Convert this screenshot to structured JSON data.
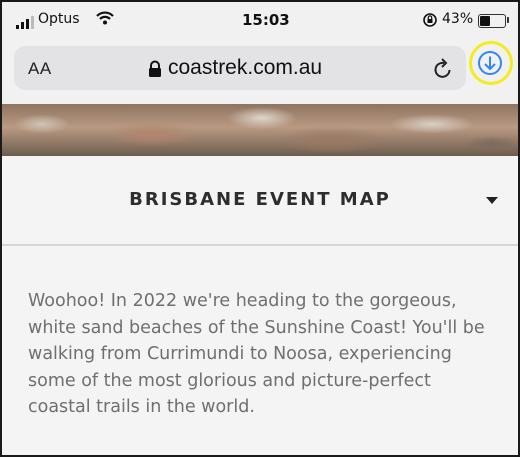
{
  "status_bar": {
    "carrier": "Optus",
    "time": "15:03",
    "battery_percent": "43%",
    "battery_level": 0.43,
    "icons": [
      "signal-bars-icon",
      "wifi-icon",
      "rotation-lock-icon",
      "battery-icon"
    ]
  },
  "address_bar": {
    "text_size_label": "AA",
    "url": "coastrek.com.au",
    "icons": [
      "padlock-icon",
      "reload-icon",
      "download-icon"
    ],
    "accent_color": "#2f86f6",
    "highlight_ring_color": "#f4ec1f"
  },
  "page": {
    "dropdown_title": "BRISBANE EVENT MAP",
    "body_text": "Woohoo! In 2022 we're heading to the gorgeous, white sand beaches of the Sunshine Coast! You'll be walking from Currimundi to Noosa, experiencing some of the most glorious and picture-perfect coastal trails in the world."
  }
}
